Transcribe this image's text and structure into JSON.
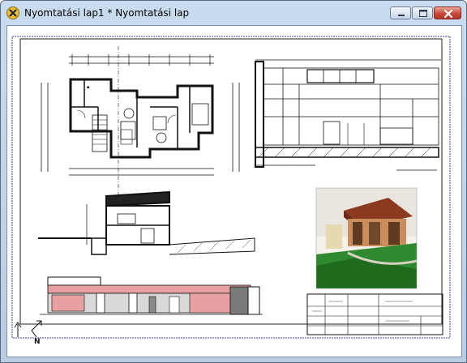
{
  "window": {
    "title": "Nyomtatási lap1 * Nyomtatási lap",
    "minimize_icon": "minimize-icon",
    "maximize_icon": "maximize-icon",
    "close_icon": "close-icon",
    "app_icon": "archicad-x-icon"
  },
  "sheet": {
    "drawings": [
      "floor-plan",
      "section-detail",
      "building-section",
      "3d-render",
      "facade-elevation",
      "title-block"
    ],
    "north_arrow_label": "N"
  },
  "colors": {
    "titlebar": "#c4d7ed",
    "close_button": "#c9483a",
    "sheet_border": "#3f3fa0",
    "roof_red": "#c0392b",
    "grass_green": "#2f8a2f",
    "elevation_pink": "#e9a0a0"
  }
}
